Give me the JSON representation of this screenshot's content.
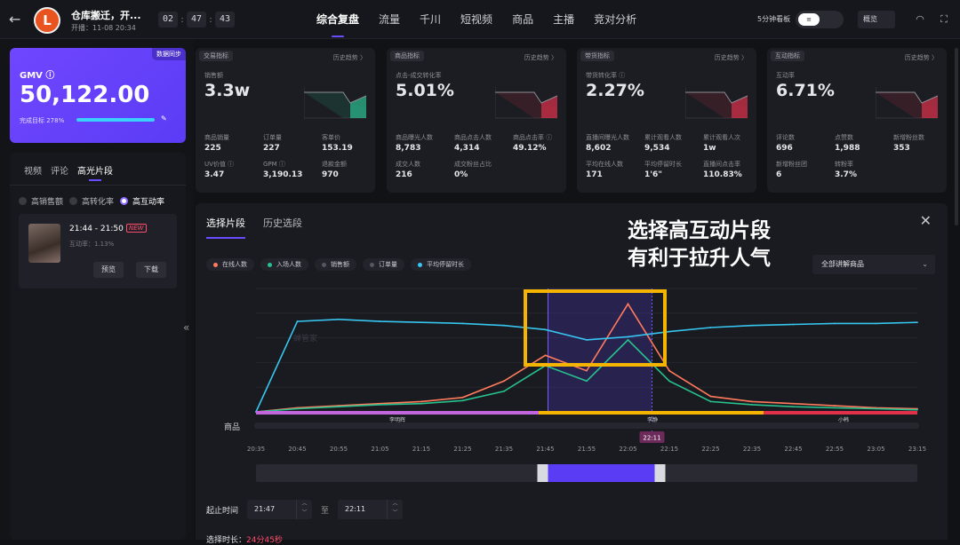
{
  "topbar": {
    "back_icon": "←",
    "avatar_text": "L",
    "shop_name": "仓库搬迁，开...",
    "live_time": "开播：11-08 20:34",
    "timer": [
      "02",
      "47",
      "43"
    ],
    "tabs": [
      "综合复盘",
      "流量",
      "千川",
      "短视频",
      "商品",
      "主播",
      "竞对分析"
    ],
    "active_tab": "综合复盘",
    "board_label": "5分钟看板",
    "toggle_text": "≡",
    "overview_label": "概览"
  },
  "gmv": {
    "sync_badge": "数据同步",
    "label": "GMV ⓘ",
    "value": "50,122.00",
    "target": "完成目标 278%",
    "progress": 1.0
  },
  "side_panel": {
    "tabs": [
      "视频",
      "评论",
      "高光片段"
    ],
    "active_tab": "高光片段",
    "filters": [
      "高销售额",
      "高转化率",
      "高互动率"
    ],
    "active_filter": "高互动率",
    "clip": {
      "time": "21:44 - 21:50",
      "badge": "NEW",
      "rate": "互动率：1.13%",
      "preview": "预览",
      "download": "下载"
    }
  },
  "metrics": [
    {
      "tag": "交易指标",
      "trend": "历史趋势 〉",
      "label": "销售额",
      "value": "3.3w",
      "spark_color": "#2bb38a",
      "cells": [
        [
          "商品销量",
          "225"
        ],
        [
          "订单量",
          "227"
        ],
        [
          "客单价",
          "153.19"
        ],
        [
          "UV价值 ⓘ",
          "3.47"
        ],
        [
          "GPM ⓘ",
          "3,190.13"
        ],
        [
          "退款金额",
          "970"
        ]
      ]
    },
    {
      "tag": "商品指标",
      "trend": "历史趋势 〉",
      "label": "点击-成交转化率",
      "value": "5.01%",
      "spark_color": "#d0304a",
      "cells": [
        [
          "商品曝光人数",
          "8,783"
        ],
        [
          "商品点击人数",
          "4,314"
        ],
        [
          "商品点击率 ⓘ",
          "49.12%"
        ],
        [
          "成交人数",
          "216"
        ],
        [
          "成交粉丝占比",
          "0%"
        ],
        [
          "",
          ""
        ]
      ]
    },
    {
      "tag": "带货指标",
      "trend": "历史趋势 〉",
      "label": "带货转化率 ⓘ",
      "value": "2.27%",
      "spark_color": "#d0304a",
      "cells": [
        [
          "直播间曝光人数",
          "8,602"
        ],
        [
          "累计观看人数",
          "9,534"
        ],
        [
          "累计观看人次",
          "1w"
        ],
        [
          "平均在线人数",
          "171"
        ],
        [
          "平均停留时长",
          "1'6\""
        ],
        [
          "直播间点击率",
          "110.83%"
        ]
      ]
    },
    {
      "tag": "互动指标",
      "trend": "历史趋势 〉",
      "label": "互动率",
      "value": "6.71%",
      "spark_color": "#d0304a",
      "cells": [
        [
          "评论数",
          "696"
        ],
        [
          "点赞数",
          "1,988"
        ],
        [
          "新增粉丝数",
          "353"
        ],
        [
          "新增粉丝团",
          "6"
        ],
        [
          "转粉率",
          "3.7%"
        ],
        [
          "",
          ""
        ]
      ]
    }
  ],
  "modal": {
    "tabs": [
      "选择片段",
      "历史选段"
    ],
    "active_tab": "选择片段",
    "close_icon": "✕",
    "headline_1": "选择高互动片段",
    "headline_2": "有利于拉升人气",
    "legend": [
      {
        "label": "在线人数",
        "color": "#ff7b5c"
      },
      {
        "label": "入场人数",
        "color": "#27c28e"
      },
      {
        "label": "销售额",
        "color": "#555660"
      },
      {
        "label": "订单量",
        "color": "#555660"
      },
      {
        "label": "平均停留时长",
        "color": "#36c6f0"
      }
    ],
    "dropdown": "全部讲解商品",
    "product_row_label": "商品",
    "anchors": [
      "李明辉",
      "李静",
      "小韩"
    ],
    "marker_time": "22:11",
    "watermark": "蝉管家",
    "start_label": "起止时间",
    "start_time": "21:47",
    "to_label": "至",
    "end_time": "22:11",
    "footer_label": "选择时长：",
    "footer_value": "24分45秒"
  },
  "chart_data": {
    "type": "line",
    "x": [
      "20:35",
      "20:45",
      "20:55",
      "21:05",
      "21:15",
      "21:25",
      "21:35",
      "21:45",
      "21:55",
      "22:05",
      "22:15",
      "22:25",
      "22:35",
      "22:45",
      "22:55",
      "23:05",
      "23:15"
    ],
    "series": [
      {
        "name": "在线人数",
        "color": "#ff7b5c",
        "values": [
          0,
          4,
          6,
          8,
          10,
          14,
          30,
          55,
          40,
          105,
          40,
          15,
          10,
          8,
          6,
          4,
          3
        ]
      },
      {
        "name": "入场人数",
        "color": "#27c28e",
        "values": [
          0,
          3,
          5,
          7,
          8,
          11,
          20,
          45,
          30,
          70,
          30,
          10,
          7,
          5,
          4,
          3,
          2
        ]
      },
      {
        "name": "平均停留时长",
        "color": "#36c6f0",
        "values": [
          0,
          88,
          90,
          88,
          87,
          86,
          84,
          80,
          70,
          73,
          78,
          82,
          84,
          85,
          86,
          86,
          87
        ]
      }
    ],
    "ylim": [
      0,
      120
    ],
    "xlabel": "",
    "ylabel": "",
    "grid": true
  }
}
